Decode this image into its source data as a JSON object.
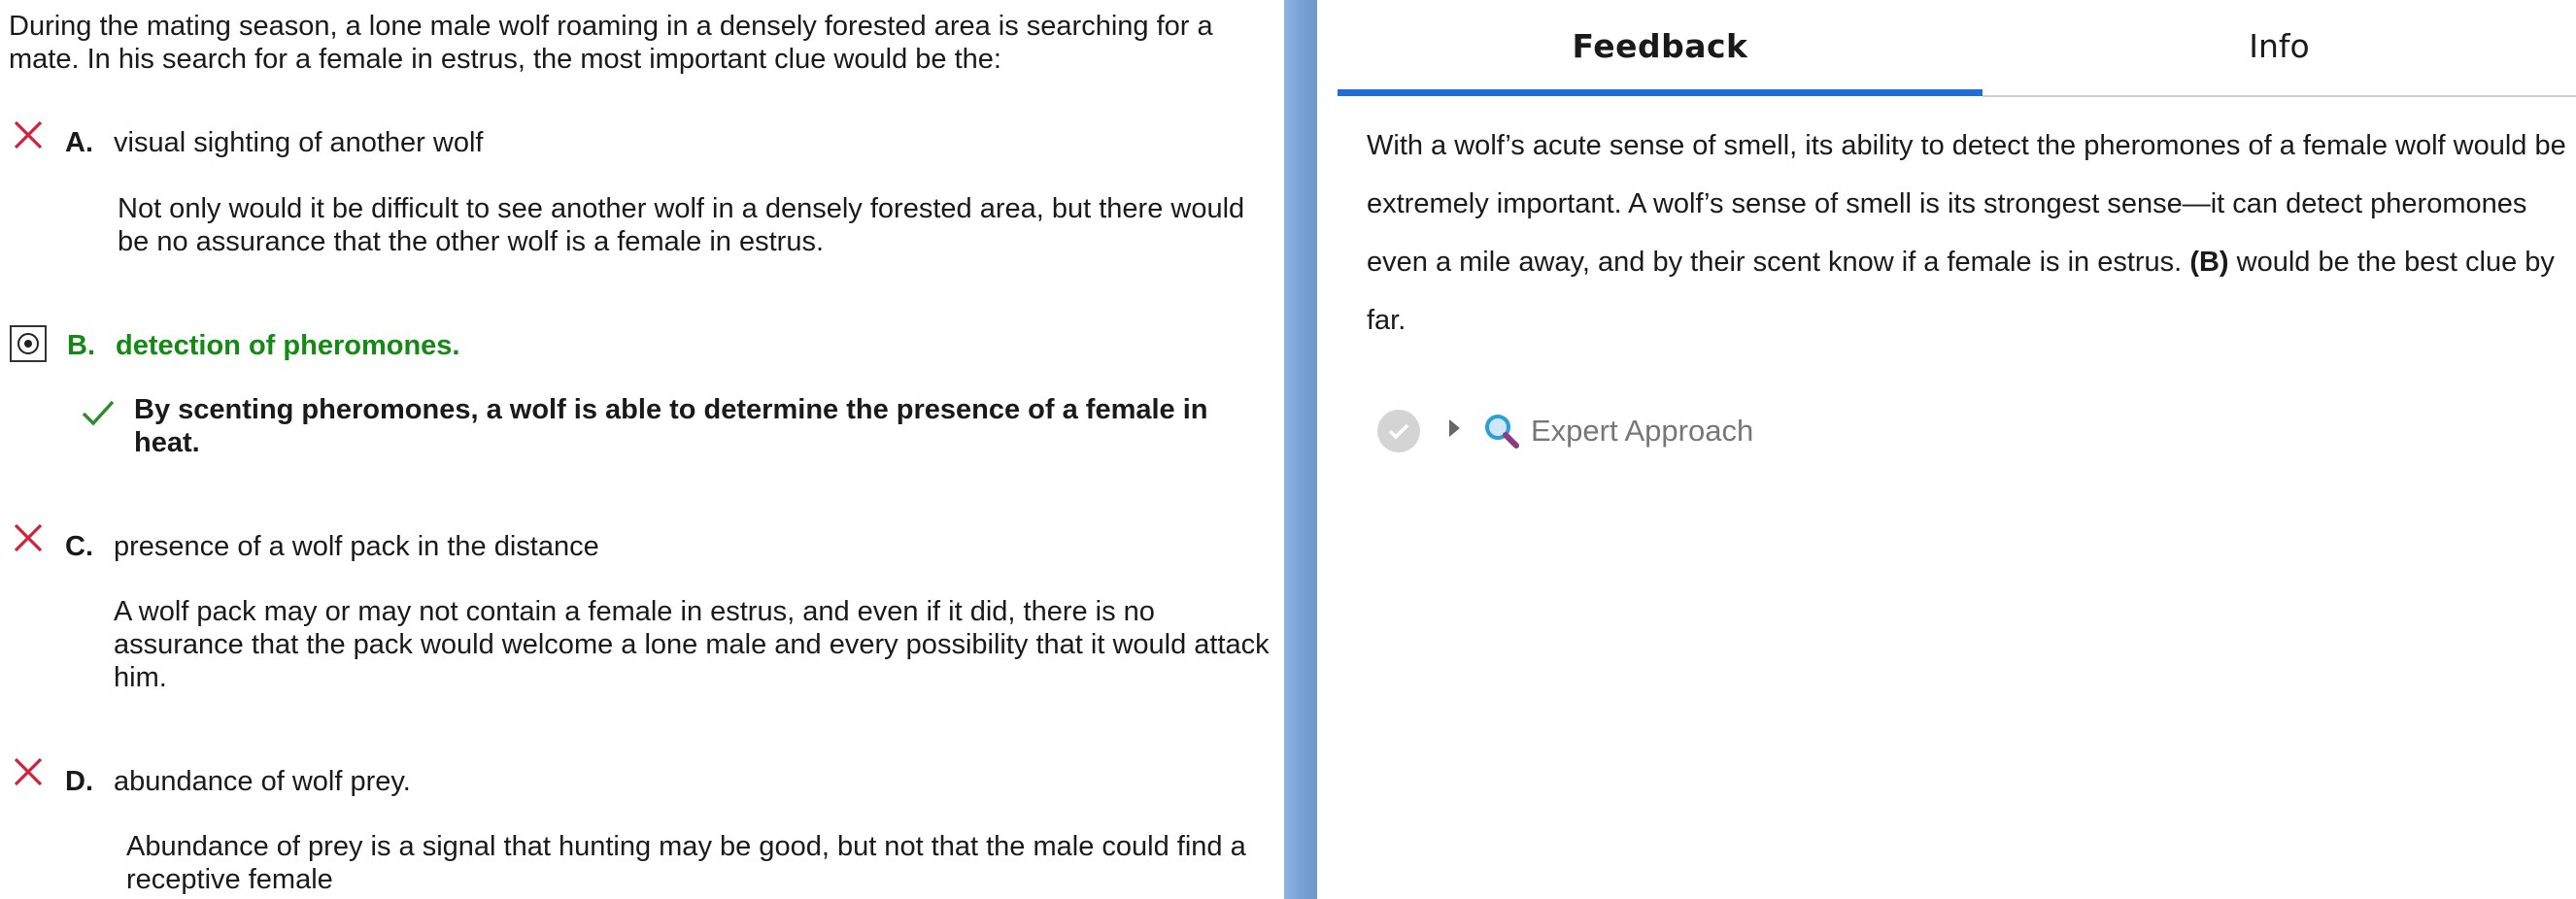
{
  "question": {
    "text": "During the mating season, a lone male wolf roaming in a densely forested area is searching for a mate. In his search for a female in estrus, the most important clue would be the:"
  },
  "choices": [
    {
      "letter": "A.",
      "text": "visual sighting of another wolf",
      "status": "incorrect",
      "explanation": "Not only would it be difficult to see another wolf in a densely forested area, but there would be no assurance that the other wolf is a female in estrus."
    },
    {
      "letter": "B.",
      "text": "detection of pheromones.",
      "status": "selected-correct",
      "explanation": "By scenting pheromones, a wolf is able to determine the presence of a female in heat."
    },
    {
      "letter": "C.",
      "text": "presence of a wolf pack in the distance",
      "status": "incorrect",
      "explanation": "A wolf pack may or may not contain a female in estrus, and even if it did, there is no assurance that the pack would welcome a lone male and every possibility that it would attack him."
    },
    {
      "letter": "D.",
      "text": "abundance of wolf prey.",
      "status": "incorrect",
      "explanation": "Abundance of prey is a signal that hunting may be good, but not that the male could find a receptive female"
    }
  ],
  "tabs": [
    {
      "label": "Feedback",
      "active": true
    },
    {
      "label": "Info",
      "active": false
    }
  ],
  "feedback": {
    "text_before": "With a wolf’s acute sense of smell, its ability to detect the pheromones of a female wolf would be extremely important. A wolf’s sense of smell is its strongest sense—it can detect pheromones even a mile away, and by their scent know if a female is in estrus. ",
    "answer_ref": "(B)",
    "text_after": " would be the best clue by far."
  },
  "expert": {
    "label": "Expert Approach",
    "check_icon": "check-circle-icon",
    "toggle_icon": "caret-right-icon",
    "search_icon": "magnifier-icon"
  },
  "colors": {
    "incorrect": "#d61f3a",
    "correct": "#138a13",
    "tab_active": "#1d6ed8",
    "divider": "#7aa3d6"
  }
}
